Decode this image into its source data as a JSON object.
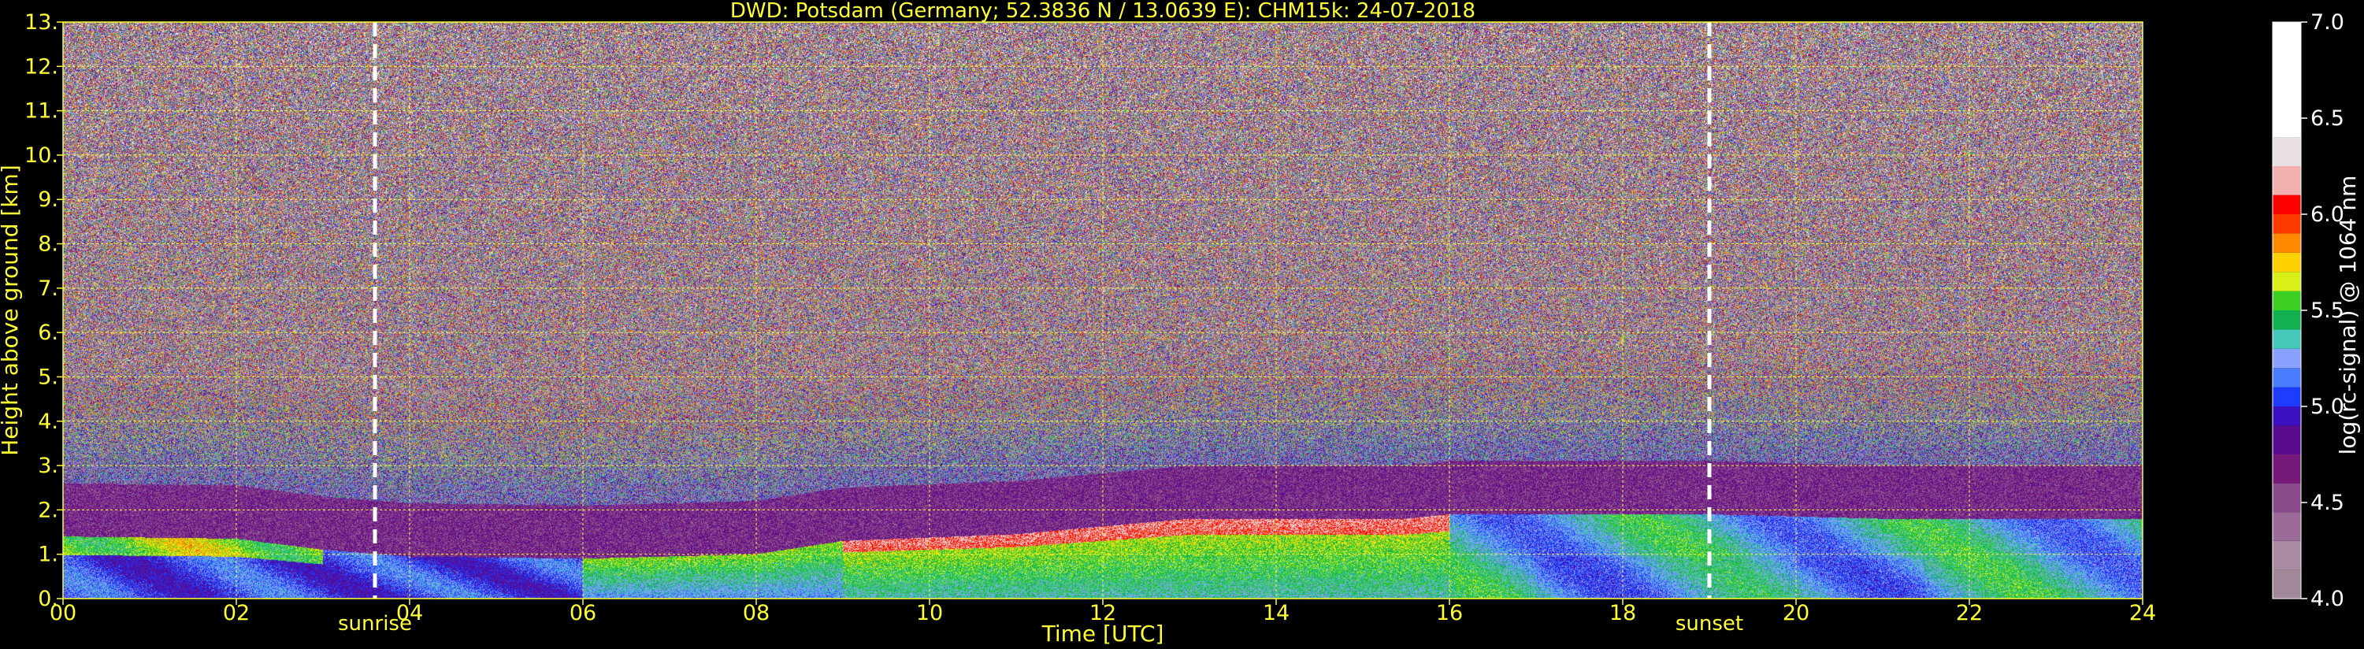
{
  "chart_data": {
    "type": "heatmap",
    "title": "DWD: Potsdam (Germany; 52.3836 N / 13.0639 E):    CHM15k: 24-07-2018",
    "xlabel": "Time [UTC]",
    "ylabel": "Height above ground [km]",
    "xlim": [
      0,
      24
    ],
    "ylim": [
      0,
      13
    ],
    "x_ticks": [
      "00",
      "02",
      "04",
      "06",
      "08",
      "10",
      "12",
      "14",
      "16",
      "18",
      "20",
      "22",
      "24"
    ],
    "y_ticks": [
      "0.",
      "1.",
      "2.",
      "3.",
      "4.",
      "5.",
      "6.",
      "7.",
      "8.",
      "9.",
      "10.",
      "11.",
      "12.",
      "13."
    ],
    "grid": true,
    "grid_color": "#ffff33",
    "text_color": "#ffff33",
    "background": "#000000",
    "annotations": [
      {
        "label": "sunrise",
        "x": 3.6
      },
      {
        "label": "sunset",
        "x": 19.0
      }
    ],
    "colorbar": {
      "label": "log(rc-signal) @ 1064 nm",
      "range": [
        4.0,
        7.0
      ],
      "ticks": [
        "4.0",
        "4.5",
        "5.0",
        "5.5",
        "6.0",
        "6.5",
        "7.0"
      ],
      "colors": [
        {
          "v": 4.0,
          "c": "#a08898"
        },
        {
          "v": 4.15,
          "c": "#a88aa2"
        },
        {
          "v": 4.3,
          "c": "#9c6a98"
        },
        {
          "v": 4.45,
          "c": "#8a4a8c"
        },
        {
          "v": 4.6,
          "c": "#761a7a"
        },
        {
          "v": 4.75,
          "c": "#5a0c8e"
        },
        {
          "v": 4.9,
          "c": "#3a10c0"
        },
        {
          "v": 5.0,
          "c": "#1e3cff"
        },
        {
          "v": 5.1,
          "c": "#4a7cff"
        },
        {
          "v": 5.2,
          "c": "#8aa2ff"
        },
        {
          "v": 5.3,
          "c": "#46c8b8"
        },
        {
          "v": 5.4,
          "c": "#12b050"
        },
        {
          "v": 5.5,
          "c": "#3cd024"
        },
        {
          "v": 5.6,
          "c": "#d8f018"
        },
        {
          "v": 5.7,
          "c": "#ffd000"
        },
        {
          "v": 5.8,
          "c": "#ff8a00"
        },
        {
          "v": 5.9,
          "c": "#ff3a00"
        },
        {
          "v": 6.0,
          "c": "#ff0000"
        },
        {
          "v": 6.1,
          "c": "#f2b0b0"
        },
        {
          "v": 6.25,
          "c": "#e8e0e0"
        },
        {
          "v": 6.4,
          "c": "#ffffff"
        },
        {
          "v": 7.0,
          "c": "#ffffff"
        }
      ]
    }
  }
}
